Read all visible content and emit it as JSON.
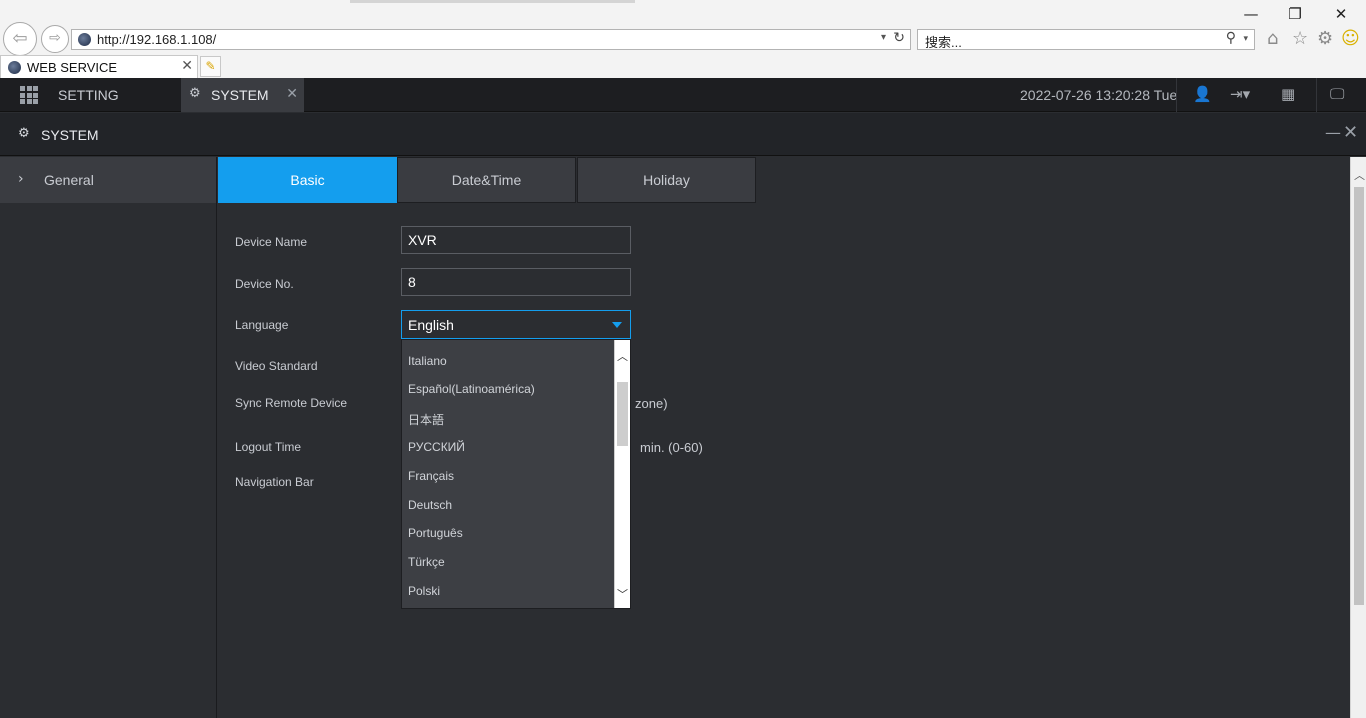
{
  "browser": {
    "url": "http://192.168.1.108/",
    "search_placeholder": "搜索...",
    "tab_title": "WEB SERVICE"
  },
  "app_header": {
    "setting_label": "SETTING",
    "active_tab_label": "SYSTEM",
    "datetime": "2022-07-26 13:20:28 Tue"
  },
  "window": {
    "title": "SYSTEM"
  },
  "sidebar": {
    "items": [
      {
        "label": "General"
      }
    ]
  },
  "tabs": [
    {
      "label": "Basic",
      "active": true
    },
    {
      "label": "Date&Time",
      "active": false
    },
    {
      "label": "Holiday",
      "active": false
    }
  ],
  "form": {
    "device_name_label": "Device Name",
    "device_name_value": "XVR",
    "device_no_label": "Device No.",
    "device_no_value": "8",
    "language_label": "Language",
    "language_value": "English",
    "video_standard_label": "Video Standard",
    "sync_remote_label": "Sync Remote Device",
    "sync_remote_suffix": "zone)",
    "logout_time_label": "Logout Time",
    "logout_time_suffix": "min. (0-60)",
    "nav_bar_label": "Navigation Bar"
  },
  "language_options": [
    "Italiano",
    "Español(Latinoamérica)",
    "日本語",
    "РУССКИЙ",
    "Français",
    "Deutsch",
    "Português",
    "Türkçe",
    "Polski"
  ],
  "colors": {
    "accent": "#149eee",
    "panel": "#2b2d31",
    "header": "#1d1e21"
  }
}
